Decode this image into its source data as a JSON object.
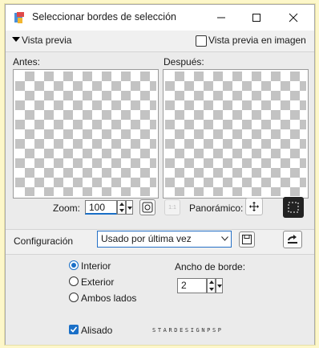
{
  "window": {
    "title": "Seleccionar bordes de selección",
    "accent_color": "#1a6fc7"
  },
  "preview": {
    "toggle_label": "Vista previa",
    "image_preview_label": "Vista previa en imagen",
    "image_preview_checked": false,
    "before_label": "Antes:",
    "after_label": "Después:"
  },
  "zoom": {
    "label": "Zoom:",
    "value": "100",
    "pan_label": "Panorámico:",
    "one_to_one_label": "1:1"
  },
  "config": {
    "label": "Configuración",
    "selected": "Usado por última vez"
  },
  "options": {
    "radios": [
      {
        "label": "Interior",
        "selected": true
      },
      {
        "label": "Exterior",
        "selected": false
      },
      {
        "label": "Ambos lados",
        "selected": false
      }
    ],
    "border_width_label": "Ancho de borde:",
    "border_width_value": "2",
    "antialias_label": "Alisado",
    "antialias_checked": true
  },
  "watermark": "STARDESIGNPSP"
}
